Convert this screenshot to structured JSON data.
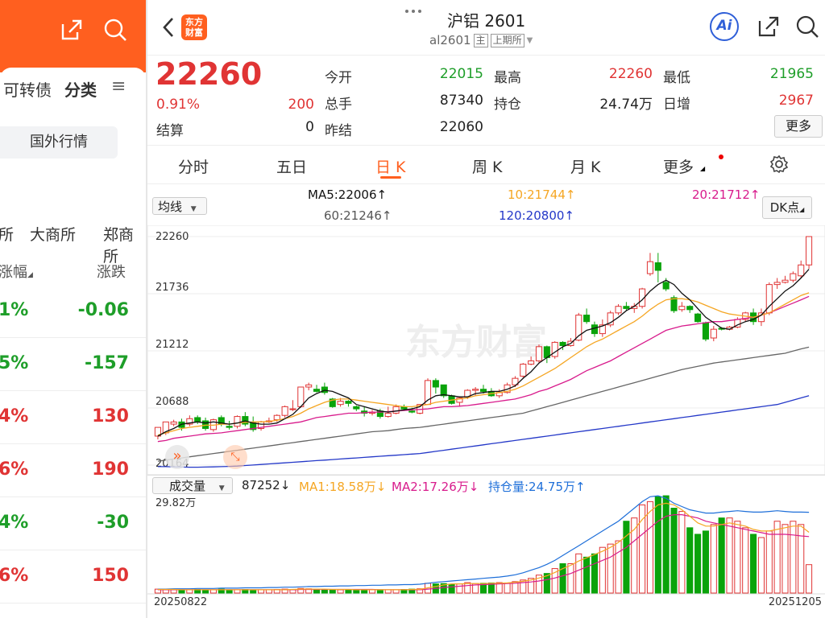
{
  "left_panel": {
    "tabs": [
      "可转债",
      "分类"
    ],
    "menu_icon": "≡",
    "foreign_button": "国外行情",
    "exchanges": [
      "所",
      "大商所",
      "郑商所"
    ],
    "col_change_pct": "涨幅",
    "col_change": "涨跌",
    "rows": [
      {
        "pct": "1%",
        "chg": "-0.06",
        "color": "green"
      },
      {
        "pct": "5%",
        "chg": "-157",
        "color": "green"
      },
      {
        "pct": "4%",
        "chg": "130",
        "color": "red"
      },
      {
        "pct": "6%",
        "chg": "190",
        "color": "red"
      },
      {
        "pct": "4%",
        "chg": "-30",
        "color": "green"
      },
      {
        "pct": "6%",
        "chg": "150",
        "color": "red"
      }
    ]
  },
  "header": {
    "logo_line1": "东方",
    "logo_line2": "财富",
    "title": "沪铝 2601",
    "code": "al2601",
    "badge_main": "主",
    "badge_exchange": "上期所",
    "ai_label": "Ai"
  },
  "quote": {
    "price": "22260",
    "change_pct": "0.91%",
    "change": "200",
    "settle_label": "结算",
    "settle": "0",
    "open_label": "今开",
    "open": "22015",
    "high_label": "最高",
    "high": "22260",
    "low_label": "最低",
    "low": "21965",
    "volume_label": "总手",
    "volume": "87340",
    "oi_label": "持仓",
    "oi": "24.74万",
    "daily_inc_label": "日增",
    "daily_inc": "2967",
    "prev_settle_label": "昨结",
    "prev_settle": "22060",
    "more_button": "更多"
  },
  "tabs": [
    "分时",
    "五日",
    "日 K",
    "周 K",
    "月 K",
    "更多"
  ],
  "active_tab": 2,
  "ma_bar": {
    "select": "均线",
    "ma5": "MA5:22006",
    "ma10": "10:21744",
    "ma20": "20:21712",
    "ma60": "60:21246",
    "ma120": "120:20800",
    "dk": "DK点"
  },
  "vol_bar": {
    "select": "成交量",
    "vol": "87252",
    "ma1": "MA1:18.58万",
    "ma2": "MA2:17.26万",
    "oi": "持仓量:24.75万"
  },
  "colors": {
    "up": "#e03434",
    "down": "#0aa30a",
    "ma5": "#111111",
    "ma10": "#f5a623",
    "ma20": "#d81b8c",
    "ma60": "#666666",
    "ma120": "#2438c8",
    "oi_line": "#1e6fd9",
    "accent": "#ff5f1f"
  },
  "watermark": "东方财富",
  "chart_data": {
    "type": "candlestick",
    "y_ticks": [
      "22260",
      "21736",
      "21212",
      "20688",
      "20164"
    ],
    "ylim": [
      20164,
      22260
    ],
    "vol_max_label": "29.82万",
    "x_start": "20250822",
    "x_end": "20251205",
    "candles": [
      [
        20430,
        20510,
        20510,
        20400
      ],
      [
        20460,
        20560,
        20560,
        20440
      ],
      [
        20540,
        20560,
        20580,
        20520
      ],
      [
        20560,
        20510,
        20590,
        20480
      ],
      [
        20540,
        20590,
        20620,
        20520
      ],
      [
        20600,
        20560,
        20620,
        20540
      ],
      [
        20570,
        20500,
        20600,
        20480
      ],
      [
        20490,
        20580,
        20590,
        20470
      ],
      [
        20600,
        20540,
        20620,
        20520
      ],
      [
        20520,
        20510,
        20570,
        20490
      ],
      [
        20520,
        20610,
        20620,
        20500
      ],
      [
        20610,
        20540,
        20650,
        20520
      ],
      [
        20550,
        20490,
        20610,
        20470
      ],
      [
        20500,
        20560,
        20570,
        20480
      ],
      [
        20560,
        20570,
        20600,
        20550
      ],
      [
        20580,
        20620,
        20630,
        20560
      ],
      [
        20620,
        20700,
        20710,
        20600
      ],
      [
        20680,
        20680,
        20760,
        20660
      ],
      [
        20700,
        20880,
        20880,
        20690
      ],
      [
        20880,
        20900,
        20920,
        20850
      ],
      [
        20860,
        20840,
        20900,
        20830
      ],
      [
        20880,
        20830,
        20920,
        20810
      ],
      [
        20770,
        20700,
        20780,
        20690
      ],
      [
        20720,
        20750,
        20780,
        20700
      ],
      [
        20750,
        20730,
        20760,
        20700
      ],
      [
        20700,
        20680,
        20710,
        20660
      ],
      [
        20660,
        20640,
        20700,
        20610
      ],
      [
        20640,
        20650,
        20670,
        20620
      ],
      [
        20660,
        20610,
        20680,
        20590
      ],
      [
        20610,
        20640,
        20700,
        20600
      ],
      [
        20640,
        20700,
        20720,
        20630
      ],
      [
        20700,
        20680,
        20720,
        20660
      ],
      [
        20660,
        20650,
        20690,
        20640
      ],
      [
        20640,
        20720,
        20720,
        20630
      ],
      [
        20720,
        20940,
        20960,
        20720
      ],
      [
        20940,
        20880,
        20960,
        20820
      ],
      [
        20900,
        20800,
        20900,
        20780
      ],
      [
        20800,
        20730,
        20810,
        20720
      ],
      [
        20740,
        20780,
        20790,
        20700
      ],
      [
        20790,
        20850,
        20860,
        20770
      ],
      [
        20850,
        20860,
        20880,
        20800
      ],
      [
        20860,
        20840,
        20900,
        20820
      ],
      [
        20840,
        20800,
        20870,
        20790
      ],
      [
        20800,
        20830,
        20860,
        20780
      ],
      [
        20830,
        20900,
        20920,
        20820
      ],
      [
        20900,
        20960,
        20980,
        20880
      ],
      [
        20980,
        21090,
        21100,
        20960
      ],
      [
        21090,
        21120,
        21160,
        21080
      ],
      [
        21120,
        21250,
        21270,
        21100
      ],
      [
        21250,
        21150,
        21260,
        21100
      ],
      [
        21160,
        21290,
        21300,
        21140
      ],
      [
        21290,
        21260,
        21300,
        21220
      ],
      [
        21260,
        21300,
        21330,
        21250
      ],
      [
        21310,
        21540,
        21560,
        21300
      ],
      [
        21540,
        21480,
        21600,
        21460
      ],
      [
        21450,
        21370,
        21480,
        21340
      ],
      [
        21370,
        21450,
        21500,
        21340
      ],
      [
        21450,
        21560,
        21580,
        21430
      ],
      [
        21560,
        21620,
        21640,
        21540
      ],
      [
        21620,
        21600,
        21660,
        21580
      ],
      [
        21600,
        21620,
        21650,
        21560
      ],
      [
        21620,
        21780,
        21790,
        21600
      ],
      [
        21920,
        22030,
        22110,
        21900
      ],
      [
        22020,
        21950,
        22110,
        21840
      ],
      [
        21840,
        21780,
        21880,
        21760
      ],
      [
        21700,
        21580,
        21720,
        21560
      ],
      [
        21590,
        21620,
        21660,
        21570
      ],
      [
        21620,
        21590,
        21630,
        21560
      ],
      [
        21550,
        21480,
        21560,
        21470
      ],
      [
        21470,
        21320,
        21480,
        21300
      ],
      [
        21330,
        21410,
        21440,
        21300
      ],
      [
        21420,
        21410,
        21430,
        21400
      ],
      [
        21410,
        21430,
        21440,
        21400
      ],
      [
        21430,
        21500,
        21520,
        21420
      ],
      [
        21500,
        21560,
        21570,
        21480
      ],
      [
        21560,
        21480,
        21600,
        21450
      ],
      [
        21480,
        21560,
        21600,
        21440
      ],
      [
        21560,
        21820,
        21840,
        21540
      ],
      [
        21820,
        21840,
        21880,
        21780
      ],
      [
        21840,
        21860,
        21900,
        21830
      ],
      [
        21860,
        21920,
        21940,
        21840
      ],
      [
        21900,
        22000,
        22040,
        21880
      ],
      [
        22000,
        22260,
        22260,
        21965
      ]
    ],
    "ma5": [
      20430,
      20470,
      20500,
      20540,
      20550,
      20560,
      20550,
      20560,
      20550,
      20540,
      20550,
      20570,
      20550,
      20540,
      20540,
      20550,
      20590,
      20630,
      20700,
      20780,
      20820,
      20850,
      20840,
      20810,
      20780,
      20720,
      20700,
      20680,
      20660,
      20650,
      20660,
      20670,
      20680,
      20700,
      20760,
      20800,
      20810,
      20800,
      20790,
      20790,
      20820,
      20830,
      20840,
      20840,
      20860,
      20890,
      20960,
      21020,
      21100,
      21150,
      21200,
      21250,
      21280,
      21350,
      21400,
      21420,
      21440,
      21470,
      21520,
      21580,
      21620,
      21680,
      21760,
      21820,
      21860,
      21820,
      21740,
      21680,
      21600,
      21520,
      21470,
      21420,
      21410,
      21450,
      21480,
      21500,
      21540,
      21620,
      21690,
      21760,
      21810,
      21880,
      21960
    ],
    "ma10": [
      20440,
      20460,
      20480,
      20500,
      20510,
      20520,
      20530,
      20530,
      20540,
      20540,
      20550,
      20555,
      20560,
      20560,
      20565,
      20575,
      20590,
      20610,
      20640,
      20680,
      20710,
      20740,
      20760,
      20770,
      20770,
      20760,
      20750,
      20740,
      20730,
      20720,
      20710,
      20700,
      20700,
      20710,
      20720,
      20740,
      20750,
      20760,
      20770,
      20780,
      20800,
      20810,
      20820,
      20830,
      20840,
      20860,
      20890,
      20930,
      20970,
      21010,
      21050,
      21100,
      21150,
      21200,
      21250,
      21290,
      21320,
      21360,
      21400,
      21440,
      21480,
      21530,
      21590,
      21640,
      21680,
      21690,
      21690,
      21680,
      21660,
      21630,
      21600,
      21570,
      21550,
      21540,
      21530,
      21520,
      21540,
      21560,
      21600,
      21640,
      21680,
      21720,
      21744
    ],
    "ma20": [
      20380,
      20390,
      20410,
      20420,
      20430,
      20440,
      20450,
      20455,
      20460,
      20470,
      20480,
      20490,
      20500,
      20510,
      20520,
      20530,
      20540,
      20550,
      20560,
      20580,
      20600,
      20610,
      20620,
      20630,
      20640,
      20640,
      20645,
      20650,
      20650,
      20655,
      20660,
      20665,
      20670,
      20675,
      20680,
      20690,
      20700,
      20700,
      20705,
      20710,
      20720,
      20730,
      20740,
      20750,
      20760,
      20770,
      20790,
      20810,
      20840,
      20860,
      20890,
      20920,
      20950,
      20990,
      21030,
      21060,
      21090,
      21120,
      21160,
      21200,
      21240,
      21280,
      21320,
      21360,
      21400,
      21420,
      21440,
      21450,
      21460,
      21470,
      21480,
      21480,
      21490,
      21500,
      21510,
      21520,
      21540,
      21560,
      21590,
      21620,
      21650,
      21680,
      21712
    ],
    "ma60": [
      20200,
      20210,
      20220,
      20230,
      20240,
      20250,
      20260,
      20270,
      20280,
      20290,
      20300,
      20310,
      20320,
      20330,
      20340,
      20350,
      20360,
      20370,
      20380,
      20390,
      20400,
      20410,
      20420,
      20430,
      20440,
      20450,
      20460,
      20470,
      20475,
      20480,
      20490,
      20500,
      20505,
      20510,
      20520,
      20530,
      20540,
      20550,
      20560,
      20570,
      20580,
      20590,
      20600,
      20610,
      20620,
      20630,
      20640,
      20660,
      20680,
      20700,
      20720,
      20740,
      20760,
      20780,
      20800,
      20820,
      20840,
      20860,
      20880,
      20900,
      20920,
      20940,
      20960,
      20980,
      21000,
      21020,
      21040,
      21055,
      21070,
      21085,
      21100,
      21110,
      21120,
      21130,
      21140,
      21150,
      21160,
      21170,
      21180,
      21190,
      21210,
      21230,
      21246
    ],
    "ma120": [
      20150,
      20150,
      20148,
      20146,
      20145,
      20145,
      20146,
      20148,
      20150,
      20152,
      20155,
      20160,
      20165,
      20170,
      20175,
      20180,
      20185,
      20190,
      20195,
      20200,
      20205,
      20210,
      20215,
      20220,
      20225,
      20230,
      20235,
      20240,
      20245,
      20250,
      20255,
      20260,
      20265,
      20270,
      20280,
      20290,
      20300,
      20310,
      20320,
      20330,
      20340,
      20350,
      20360,
      20370,
      20380,
      20390,
      20400,
      20410,
      20420,
      20430,
      20440,
      20450,
      20460,
      20470,
      20480,
      20490,
      20500,
      20510,
      20520,
      20530,
      20540,
      20550,
      20560,
      20570,
      20580,
      20590,
      20600,
      20610,
      20620,
      20630,
      20640,
      20650,
      20660,
      20670,
      20680,
      20690,
      20700,
      20710,
      20720,
      20740,
      20760,
      20780,
      20800
    ],
    "volume": [
      1.2,
      1.0,
      1.1,
      0.9,
      1.0,
      1.1,
      0.9,
      1.0,
      1.2,
      0.9,
      1.0,
      1.1,
      0.9,
      1.0,
      1.0,
      1.1,
      1.2,
      1.0,
      1.4,
      1.3,
      1.2,
      1.1,
      1.0,
      1.0,
      1.1,
      1.0,
      1.0,
      1.1,
      1.0,
      1.0,
      1.0,
      1.1,
      1.2,
      1.3,
      3.0,
      2.8,
      2.9,
      2.7,
      2.8,
      3.2,
      2.9,
      3.0,
      3.1,
      3.2,
      3.0,
      3.5,
      4.0,
      4.5,
      5.5,
      6.0,
      7.5,
      9.0,
      9.0,
      12.0,
      11.0,
      12.0,
      14.0,
      15.0,
      16.0,
      22.0,
      23.0,
      27.0,
      28.0,
      29.5,
      29.8,
      26.0,
      25.0,
      20.0,
      18.0,
      19.0,
      21.0,
      23.0,
      23.0,
      22.0,
      20.0,
      18.0,
      17.0,
      19.0,
      22.0,
      21.0,
      22.0,
      21.0,
      8.7
    ],
    "vol_ma1": [
      1.1,
      1.1,
      1.1,
      1.0,
      1.0,
      1.0,
      1.0,
      1.0,
      1.0,
      1.0,
      1.0,
      1.0,
      1.0,
      1.0,
      1.0,
      1.0,
      1.0,
      1.1,
      1.2,
      1.2,
      1.2,
      1.2,
      1.1,
      1.1,
      1.1,
      1.0,
      1.0,
      1.0,
      1.0,
      1.0,
      1.0,
      1.0,
      1.1,
      1.1,
      1.6,
      2.0,
      2.5,
      2.8,
      2.8,
      2.9,
      2.9,
      2.9,
      3.0,
      3.0,
      3.1,
      3.3,
      3.6,
      4.0,
      4.6,
      5.3,
      6.3,
      7.5,
      8.5,
      9.8,
      10.8,
      11.8,
      12.8,
      14.0,
      15.5,
      17.5,
      19.5,
      22.5,
      25.0,
      27.0,
      27.5,
      27.0,
      25.5,
      23.5,
      21.5,
      20.5,
      20.5,
      21.0,
      21.5,
      21.0,
      20.5,
      19.5,
      19.0,
      19.0,
      19.5,
      20.0,
      20.5,
      20.5,
      18.6
    ],
    "vol_ma2": [
      1.0,
      1.0,
      1.0,
      1.0,
      1.0,
      1.0,
      1.0,
      1.0,
      1.0,
      1.0,
      1.0,
      1.0,
      1.0,
      1.0,
      1.0,
      1.0,
      1.0,
      1.0,
      1.1,
      1.1,
      1.1,
      1.1,
      1.1,
      1.1,
      1.1,
      1.1,
      1.1,
      1.1,
      1.0,
      1.0,
      1.0,
      1.0,
      1.0,
      1.0,
      1.2,
      1.4,
      1.7,
      1.9,
      2.1,
      2.3,
      2.5,
      2.6,
      2.7,
      2.8,
      2.9,
      3.0,
      3.2,
      3.4,
      3.7,
      4.1,
      4.6,
      5.3,
      6.0,
      7.0,
      8.0,
      9.0,
      10.0,
      11.0,
      12.5,
      14.0,
      16.0,
      18.0,
      20.0,
      22.0,
      23.5,
      24.0,
      24.0,
      23.5,
      23.0,
      22.0,
      21.5,
      21.0,
      20.5,
      20.0,
      19.5,
      19.0,
      18.5,
      18.0,
      18.0,
      18.0,
      17.8,
      17.5,
      17.3
    ],
    "open_interest": [
      1.2,
      1.2,
      1.3,
      1.3,
      1.3,
      1.4,
      1.4,
      1.4,
      1.5,
      1.5,
      1.5,
      1.6,
      1.6,
      1.6,
      1.7,
      1.7,
      1.8,
      1.8,
      1.9,
      2.0,
      2.0,
      2.1,
      2.1,
      2.2,
      2.2,
      2.3,
      2.3,
      2.4,
      2.4,
      2.5,
      2.5,
      2.6,
      2.6,
      2.7,
      3.0,
      3.3,
      3.5,
      3.7,
      3.9,
      4.1,
      4.3,
      4.5,
      4.7,
      4.9,
      5.2,
      5.6,
      6.2,
      7.0,
      7.8,
      8.8,
      10.0,
      11.5,
      13.0,
      14.5,
      16.0,
      17.5,
      19.0,
      20.5,
      22.0,
      24.0,
      26.0,
      28.0,
      29.5,
      29.8,
      29.0,
      27.5,
      26.5,
      25.5,
      25.0,
      24.5,
      24.5,
      24.8,
      25.0,
      25.2,
      25.0,
      24.8,
      24.8,
      25.0,
      25.2,
      25.0,
      24.8,
      24.8,
      24.75
    ]
  }
}
